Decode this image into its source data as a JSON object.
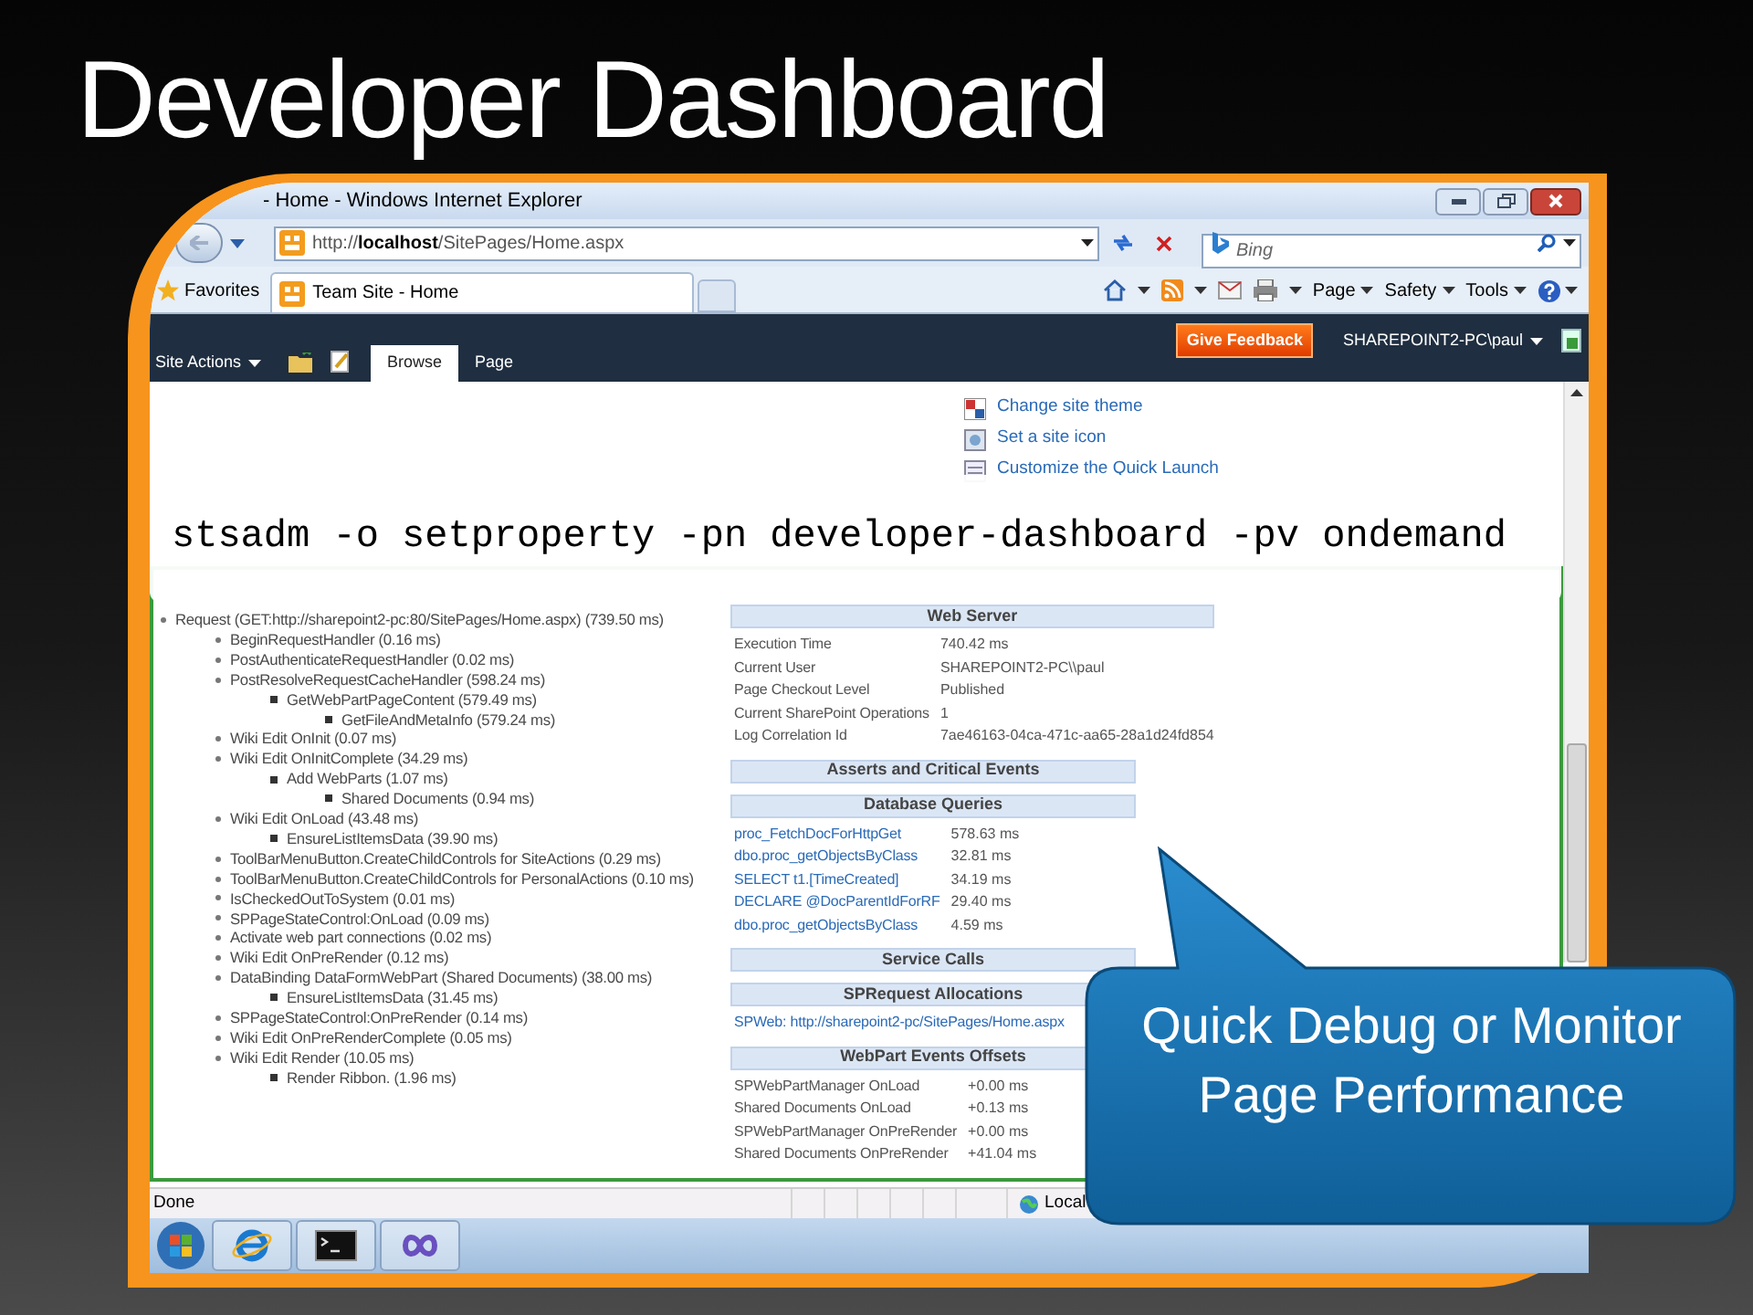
{
  "slide": {
    "title": "Developer Dashboard"
  },
  "browser": {
    "title": "- Home - Windows Internet Explorer",
    "address": "http://**localhost**/SitePages/Home.aspx",
    "search": {
      "placeholder": "Bing"
    },
    "favorites": "Favorites",
    "tabs": [
      {
        "label": "Team Site - Home",
        "selected": true
      }
    ],
    "commands": [
      "Page",
      "Safety",
      "Tools"
    ],
    "status": "Done",
    "zone": "Local"
  },
  "sharepoint": {
    "site_actions": "Site Actions",
    "ribbon_tabs": [
      {
        "label": "Browse",
        "selected": true
      },
      {
        "label": "Page",
        "selected": false
      }
    ],
    "feedback": "Give Feedback",
    "user": "SHAREPOINT2-PC\\paul",
    "settings_links": [
      "Change site theme",
      "Set a site icon",
      "Customize the Quick Launch"
    ]
  },
  "command": "stsadm -o setproperty -pn developer-dashboard -pv ondemand",
  "dashboard": {
    "tree": [
      {
        "label": "Request (GET:http://sharepoint2-pc:80/SitePages/Home.aspx) (739.50 ms)",
        "children": [
          {
            "label": "BeginRequestHandler (0.16 ms)"
          },
          {
            "label": "PostAuthenticateRequestHandler (0.02 ms)"
          },
          {
            "label": "PostResolveRequestCacheHandler (598.24 ms)",
            "children": [
              {
                "label": "GetWebPartPageContent (579.49 ms)",
                "children": [
                  {
                    "label": "GetFileAndMetaInfo (579.24 ms)"
                  }
                ]
              }
            ]
          },
          {
            "label": "Wiki Edit OnInit (0.07 ms)"
          },
          {
            "label": "Wiki Edit OnInitComplete (34.29 ms)",
            "children": [
              {
                "label": "Add WebParts (1.07 ms)",
                "children": [
                  {
                    "label": "Shared Documents (0.94 ms)"
                  }
                ]
              }
            ]
          },
          {
            "label": "Wiki Edit OnLoad (43.48 ms)",
            "children": [
              {
                "label": "EnsureListItemsData (39.90 ms)"
              }
            ]
          },
          {
            "label": "ToolBarMenuButton.CreateChildControls for SiteActions (0.29 ms)"
          },
          {
            "label": "ToolBarMenuButton.CreateChildControls for PersonalActions (0.10 ms)"
          },
          {
            "label": "IsCheckedOutToSystem (0.01 ms)"
          },
          {
            "label": "SPPageStateControl:OnLoad (0.09 ms)"
          },
          {
            "label": "Activate web part connections (0.02 ms)"
          },
          {
            "label": "Wiki Edit OnPreRender (0.12 ms)"
          },
          {
            "label": "DataBinding DataFormWebPart (Shared Documents) (38.00 ms)",
            "children": [
              {
                "label": "EnsureListItemsData (31.45 ms)"
              }
            ]
          },
          {
            "label": "SPPageStateControl:OnPreRender (0.14 ms)"
          },
          {
            "label": "Wiki Edit OnPreRenderComplete (0.05 ms)"
          },
          {
            "label": "Wiki Edit Render (10.05 ms)",
            "children": [
              {
                "label": "Render Ribbon. (1.96 ms)"
              }
            ]
          }
        ]
      }
    ],
    "sections": [
      {
        "title": "Web Server",
        "rows": [
          {
            "label": "Execution Time",
            "value": "740.42 ms",
            "link": false
          },
          {
            "label": "Current User",
            "value": "SHAREPOINT2-PC\\\\paul",
            "link": false
          },
          {
            "label": "Page Checkout Level",
            "value": "Published",
            "link": false
          },
          {
            "label": "Current SharePoint Operations",
            "value": "1",
            "link": false
          },
          {
            "label": "Log Correlation Id",
            "value": "7ae46163-04ca-471c-aa65-28a1d24fd854",
            "link": false
          }
        ]
      },
      {
        "title": "Asserts and Critical Events"
      },
      {
        "title": "Database Queries",
        "rows": [
          {
            "label": "proc_FetchDocForHttpGet",
            "value": "578.63 ms",
            "link": true
          },
          {
            "label": "dbo.proc_getObjectsByClass",
            "value": "32.81 ms",
            "link": true
          },
          {
            "label": "SELECT t1.[TimeCreated]",
            "value": "34.19 ms",
            "link": true
          },
          {
            "label": "DECLARE @DocParentIdForRF",
            "value": "29.40 ms",
            "link": true
          },
          {
            "label": "dbo.proc_getObjectsByClass",
            "value": "4.59 ms",
            "link": true
          }
        ]
      },
      {
        "title": "Service Calls"
      },
      {
        "title": "SPRequest Allocations",
        "rows": [
          {
            "label": "SPWeb: http://sharepoint2-pc/SitePages/Home.aspx",
            "link": true
          }
        ]
      },
      {
        "title": "WebPart Events Offsets",
        "rows": [
          {
            "label": "SPWebPartManager OnLoad",
            "value": "+0.00 ms",
            "link": false
          },
          {
            "label": "Shared Documents OnLoad",
            "value": "+0.13 ms",
            "link": false
          },
          {
            "label": "SPWebPartManager OnPreRender",
            "value": "+0.00 ms",
            "link": false
          },
          {
            "label": "Shared Documents OnPreRender",
            "value": "+41.04 ms",
            "link": false
          }
        ]
      }
    ]
  },
  "callout": "Quick Debug or Monitor Page Performance"
}
